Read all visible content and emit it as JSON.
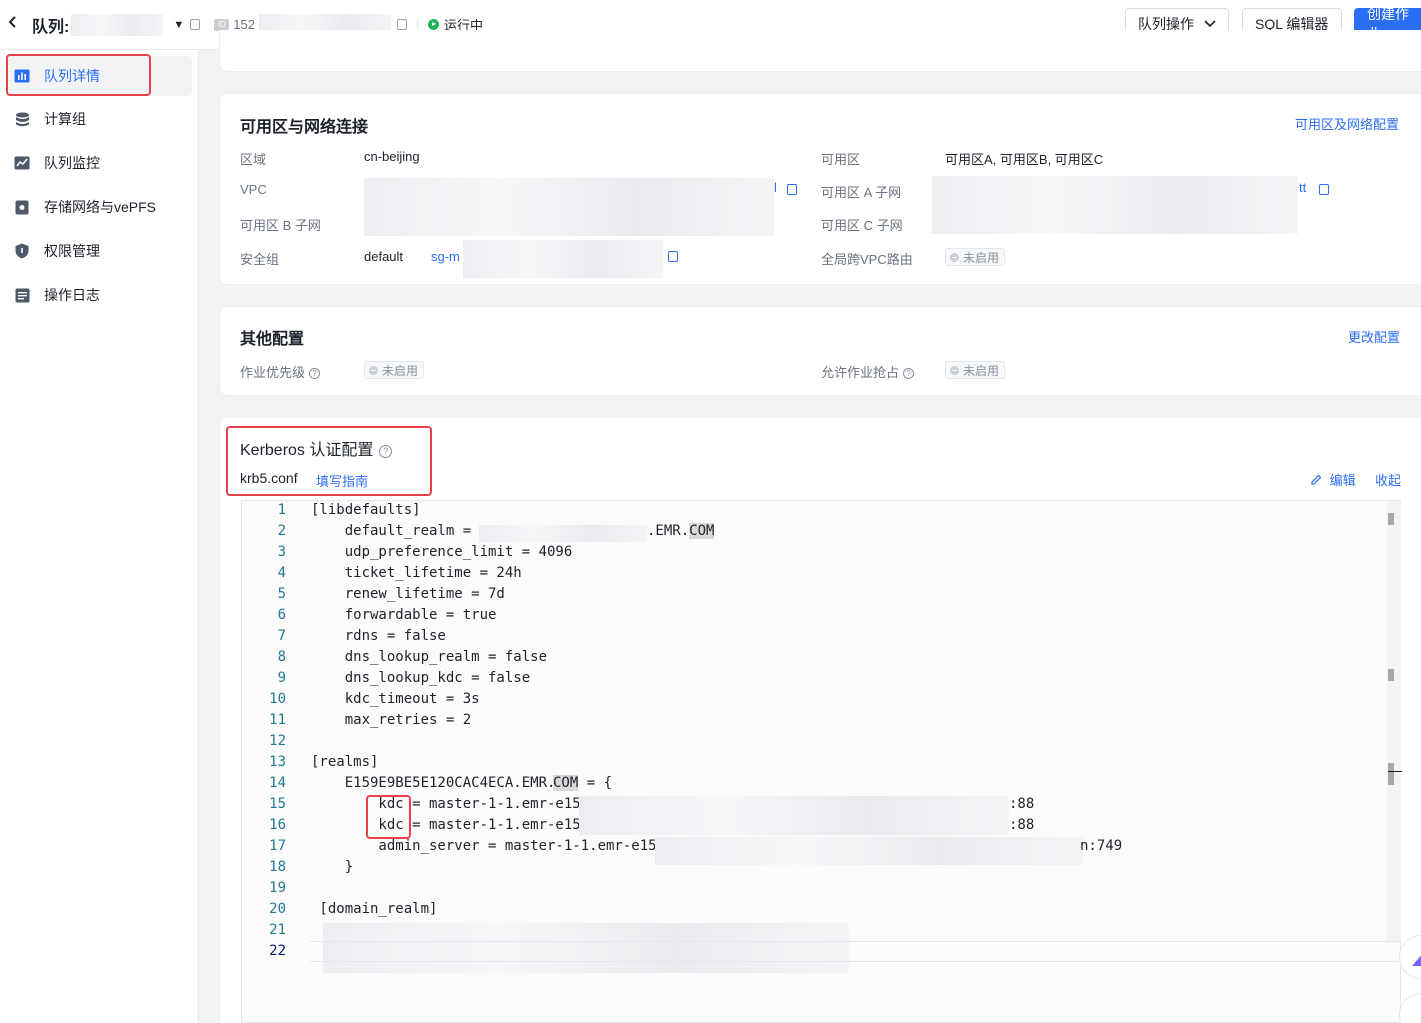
{
  "header": {
    "queue_label": "队列:",
    "id_icon": "ID",
    "id_value": "152",
    "status": "运行中",
    "queue_ops_button": "队列操作",
    "sql_editor_button": "SQL 编辑器",
    "create_job_button": "创建作业"
  },
  "sidebar": {
    "items": [
      {
        "label": "队列详情",
        "icon": "bar-chart-icon"
      },
      {
        "label": "计算组",
        "icon": "database-icon"
      },
      {
        "label": "队列监控",
        "icon": "monitor-chart-icon"
      },
      {
        "label": "存储网络与vePFS",
        "icon": "storage-icon"
      },
      {
        "label": "权限管理",
        "icon": "shield-icon"
      },
      {
        "label": "操作日志",
        "icon": "log-icon"
      }
    ]
  },
  "network": {
    "title": "可用区与网络连接",
    "config_link": "可用区及网络配置",
    "region_label": "区域",
    "region_value": "cn-beijing",
    "vpc_label": "VPC",
    "vpc_value_tail": "l",
    "subnet_b_label": "可用区 B 子网",
    "security_group_label": "安全组",
    "security_group_default": "default",
    "security_group_id": "sg-m",
    "zone_label": "可用区",
    "zone_value": "可用区A, 可用区B, 可用区C",
    "subnet_a_label": "可用区 A 子网",
    "subnet_a_tail": "tt",
    "subnet_c_label": "可用区 C 子网",
    "cross_vpc_label": "全局跨VPC路由",
    "cross_vpc_value": "未启用"
  },
  "other": {
    "title": "其他配置",
    "edit_link": "更改配置",
    "priority_label": "作业优先级",
    "priority_value": "未启用",
    "preempt_label": "允许作业抢占",
    "preempt_value": "未启用"
  },
  "kerberos": {
    "title": "Kerberos 认证配置",
    "file_label": "krb5.conf",
    "guide_link": "填写指南",
    "edit_link": "编辑",
    "collapse_link": "收起"
  },
  "code_lines": [
    {
      "n": "1",
      "text": "[libdefaults]"
    },
    {
      "n": "2",
      "text": "    default_realm = "
    },
    {
      "n": "3",
      "text": "    udp_preference_limit = 4096"
    },
    {
      "n": "4",
      "text": "    ticket_lifetime = 24h"
    },
    {
      "n": "5",
      "text": "    renew_lifetime = 7d"
    },
    {
      "n": "6",
      "text": "    forwardable = true"
    },
    {
      "n": "7",
      "text": "    rdns = false"
    },
    {
      "n": "8",
      "text": "    dns_lookup_realm = false"
    },
    {
      "n": "9",
      "text": "    dns_lookup_kdc = false"
    },
    {
      "n": "10",
      "text": "    kdc_timeout = 3s"
    },
    {
      "n": "11",
      "text": "    max_retries = 2"
    },
    {
      "n": "12",
      "text": ""
    },
    {
      "n": "13",
      "text": "[realms]"
    },
    {
      "n": "14",
      "text": "    E159E9BE5E120CAC4ECA.EMR."
    },
    {
      "n": "15",
      "text": "        kdc = master-1-1.emr-e15"
    },
    {
      "n": "16",
      "text": "        kdc = master-1-1.emr-e15"
    },
    {
      "n": "17",
      "text": "        admin_server = master-1-1.emr-e15"
    },
    {
      "n": "18",
      "text": "    }"
    },
    {
      "n": "19",
      "text": ""
    },
    {
      "n": "20",
      "text": " [domain_realm]"
    },
    {
      "n": "21",
      "text": ""
    },
    {
      "n": "22",
      "text": ""
    }
  ],
  "code_fragments": {
    "l2_suffix": ".EMR.",
    "com": "COM",
    "l14_tail": " = {",
    "l15_tail": ":88",
    "l16_tail": ":88",
    "l17_tail": "n:749"
  }
}
